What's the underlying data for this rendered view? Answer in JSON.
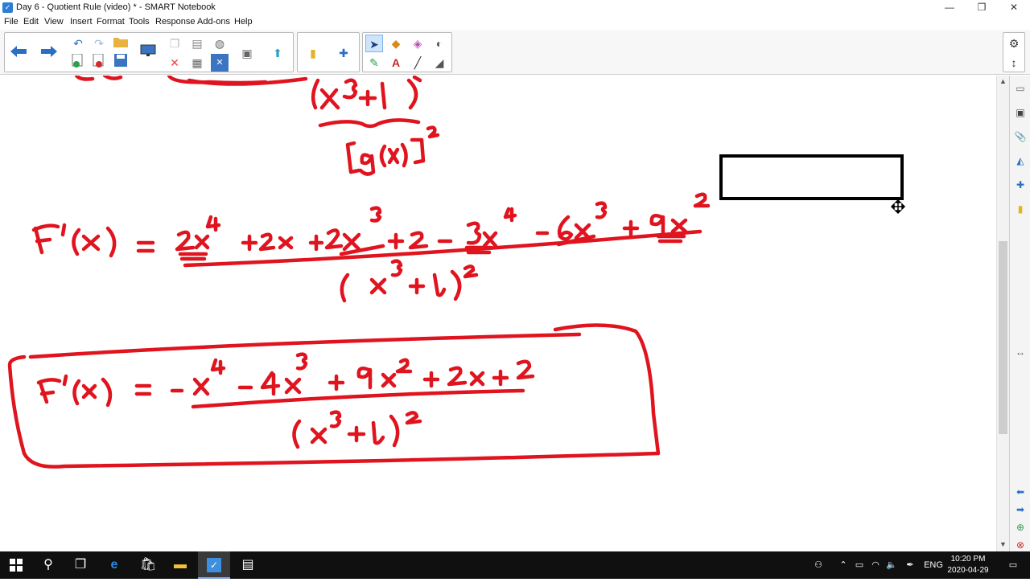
{
  "window": {
    "title": "Day 6 - Quotient Rule (video) * - SMART Notebook",
    "app_icon_glyph": "✓",
    "controls": [
      "—",
      "❐",
      "✕"
    ]
  },
  "menu": [
    "File",
    "Edit",
    "View",
    "Insert",
    "Format",
    "Tools",
    "Response",
    "Add-ons",
    "Help"
  ],
  "toolbar": {
    "icons": [
      "back-arrow-icon",
      "forward-arrow-icon",
      "undo-icon",
      "redo-icon",
      "open-folder-icon",
      "add-page-icon",
      "delete-page-icon",
      "save-icon",
      "screen-shade-icon",
      "paste-icon",
      "table-icon",
      "delete-icon",
      "web-browser-icon",
      "capture-icon",
      "document-camera-icon",
      "gallery-icon",
      "add-ons-icon",
      "select-icon",
      "pens-icon",
      "shapes-icon",
      "eraser-icon",
      "fill-icon",
      "text-icon",
      "lines-icon",
      "magic-pen-icon",
      "settings-icon",
      "move-toolbar-icon"
    ]
  },
  "accent_color": "#e0141e",
  "canvas": {
    "ink_color": "#e0141e",
    "box_color": "#000000"
  },
  "sidetabs": [
    "page-sorter-icon",
    "gallery-icon",
    "attachments-icon",
    "properties-icon",
    "add-ons-icon",
    "lesson-activity-icon"
  ],
  "taskbar": {
    "language": "ENG",
    "time": "10:20 PM",
    "date": "2020-04-29"
  }
}
